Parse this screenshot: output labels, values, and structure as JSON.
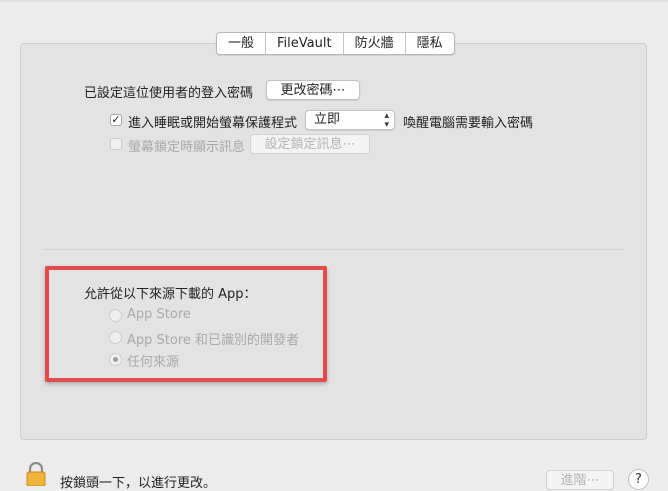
{
  "tabs": [
    {
      "label": "一般",
      "active": true
    },
    {
      "label": "FileVault",
      "active": false
    },
    {
      "label": "防火牆",
      "active": false
    },
    {
      "label": "隱私",
      "active": false
    }
  ],
  "general": {
    "password_label": "已設定這位使用者的登入密碼",
    "change_password_button": "更改密碼⋯",
    "require_password_checkbox_label": "進入睡眠或開始螢幕保護程式",
    "require_password_checked": true,
    "require_password_delay": "立即",
    "require_password_suffix": "喚醒電腦需要輸入密碼",
    "show_message_checkbox_label": "螢幕鎖定時顯示訊息",
    "show_message_checked": false,
    "set_lock_message_button": "設定鎖定訊息⋯"
  },
  "allow_apps": {
    "heading": "允許從以下來源下載的 App：",
    "options": [
      {
        "label": "App Store",
        "selected": false
      },
      {
        "label": "App Store 和已識別的開發者",
        "selected": false
      },
      {
        "label": "任何來源",
        "selected": true
      }
    ]
  },
  "footer": {
    "lock_text": "按鎖頭一下，以進行更改。",
    "advanced_button": "進階⋯",
    "help_label": "?"
  },
  "colors": {
    "highlight_border": "#e24b4b",
    "panel_background": "#e3e3e3"
  }
}
